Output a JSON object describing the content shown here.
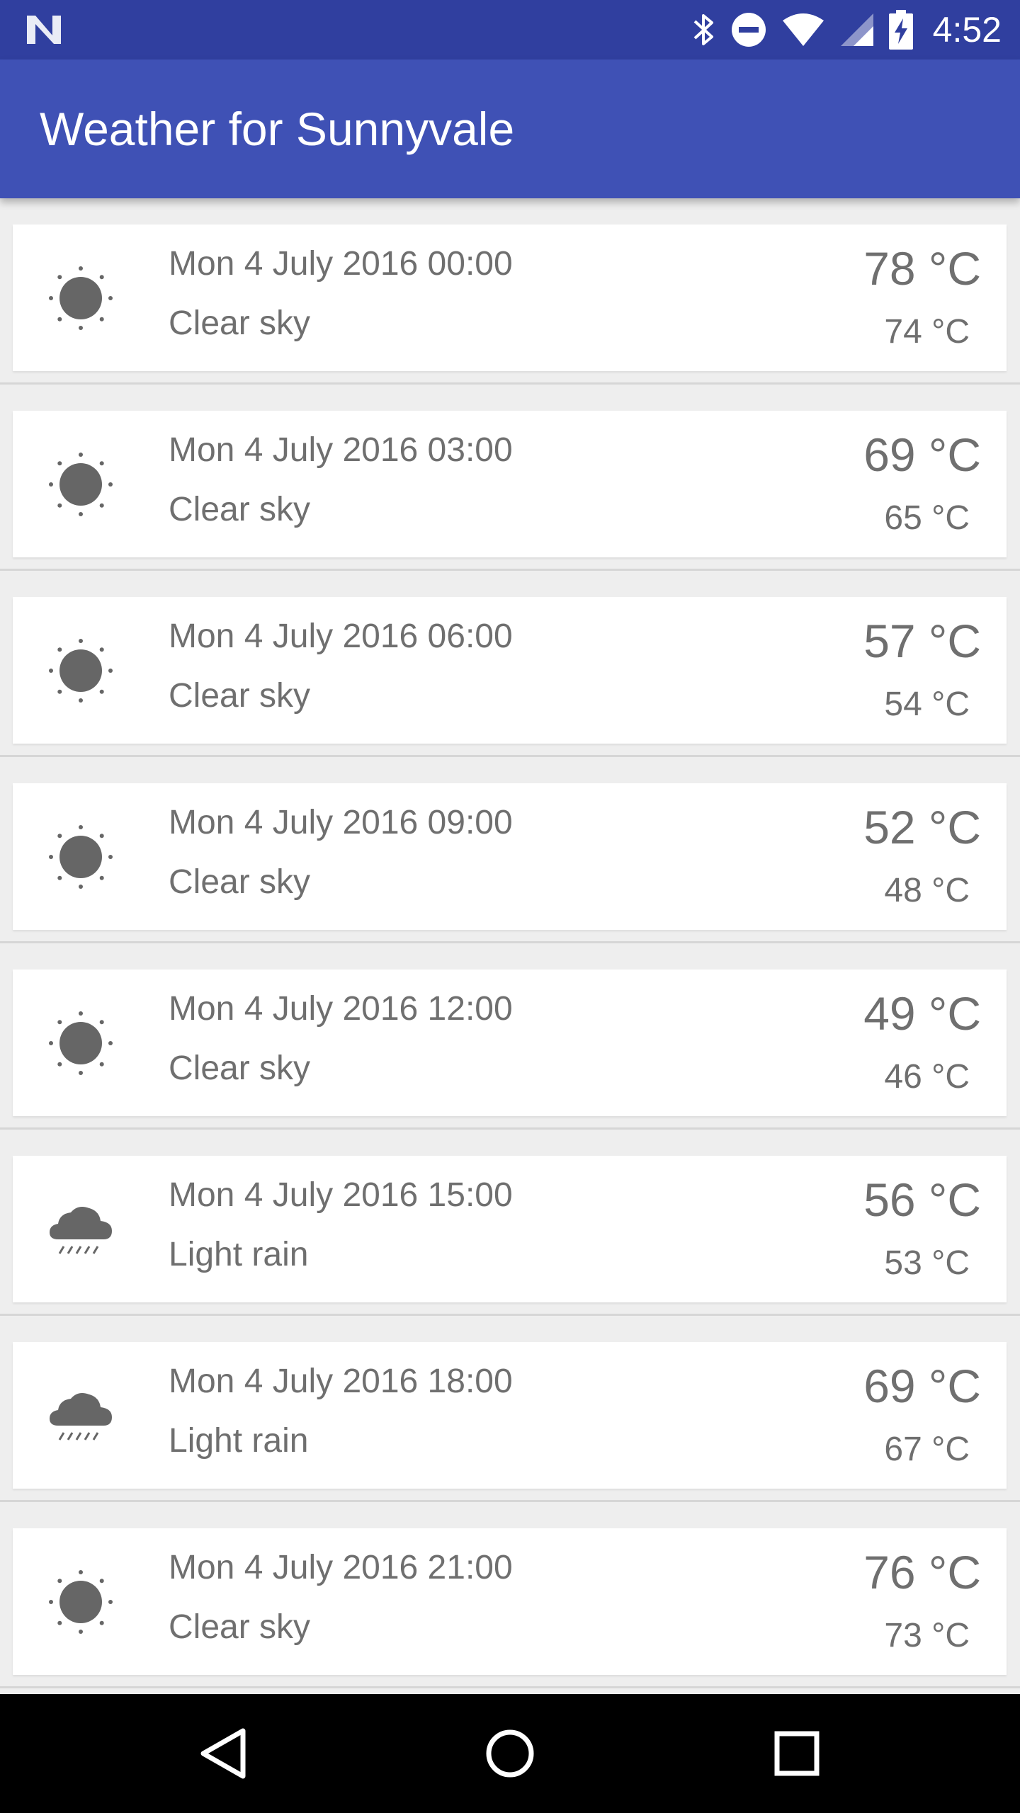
{
  "status_bar": {
    "time": "4:52",
    "icons": [
      "bluetooth-icon",
      "do-not-disturb-icon",
      "wifi-icon",
      "signal-icon",
      "battery-charging-icon"
    ]
  },
  "app_bar": {
    "title": "Weather for Sunnyvale"
  },
  "forecast": [
    {
      "date": "Mon 4 July 2016 00:00",
      "description": "Clear sky",
      "high": "78 °C",
      "low": "74 °C",
      "icon": "sun-icon"
    },
    {
      "date": "Mon 4 July 2016 03:00",
      "description": "Clear sky",
      "high": "69 °C",
      "low": "65 °C",
      "icon": "sun-icon"
    },
    {
      "date": "Mon 4 July 2016 06:00",
      "description": "Clear sky",
      "high": "57 °C",
      "low": "54 °C",
      "icon": "sun-icon"
    },
    {
      "date": "Mon 4 July 2016 09:00",
      "description": "Clear sky",
      "high": "52 °C",
      "low": "48 °C",
      "icon": "sun-icon"
    },
    {
      "date": "Mon 4 July 2016 12:00",
      "description": "Clear sky",
      "high": "49 °C",
      "low": "46 °C",
      "icon": "sun-icon"
    },
    {
      "date": "Mon 4 July 2016 15:00",
      "description": "Light rain",
      "high": "56 °C",
      "low": "53 °C",
      "icon": "rain-cloud-icon"
    },
    {
      "date": "Mon 4 July 2016 18:00",
      "description": "Light rain",
      "high": "69 °C",
      "low": "67 °C",
      "icon": "rain-cloud-icon"
    },
    {
      "date": "Mon 4 July 2016 21:00",
      "description": "Clear sky",
      "high": "76 °C",
      "low": "73 °C",
      "icon": "sun-icon"
    }
  ],
  "nav_bar": {
    "buttons": [
      "back-icon",
      "home-icon",
      "recents-icon"
    ]
  },
  "colors": {
    "status_bar": "#303f9f",
    "app_bar": "#3f51b5",
    "text": "#6f6f6f",
    "icon": "#666666"
  }
}
